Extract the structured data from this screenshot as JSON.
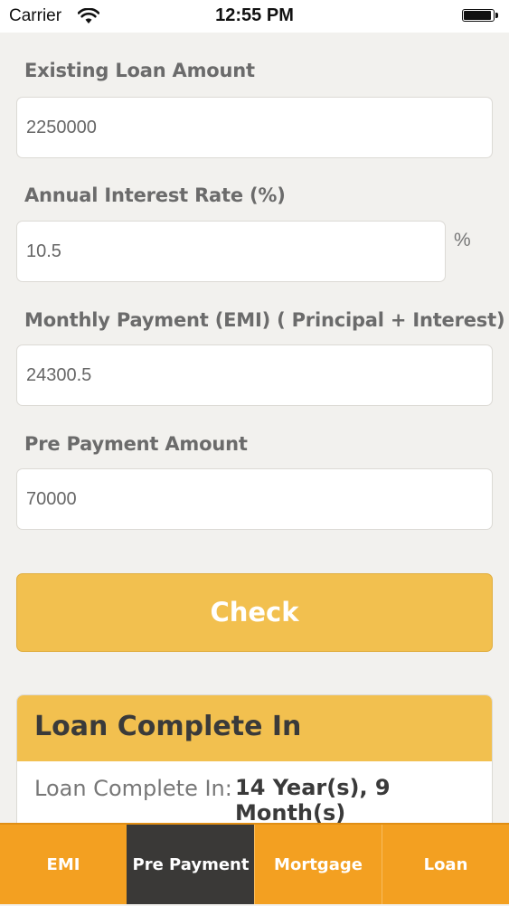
{
  "status_bar": {
    "carrier": "Carrier",
    "time": "12:55 PM"
  },
  "form": {
    "loan_amount": {
      "label": "Existing Loan Amount",
      "value": "2250000"
    },
    "interest_rate": {
      "label": "Annual Interest Rate (%)",
      "value": "10.5",
      "unit": "%"
    },
    "emi": {
      "label": "Monthly Payment (EMI) ( Principal + Interest)",
      "value": "24300.5"
    },
    "prepayment": {
      "label": "Pre Payment Amount",
      "value": "70000"
    },
    "check_label": "Check"
  },
  "result": {
    "title": "Loan Complete In",
    "label": "Loan Complete In:",
    "value": "14 Year(s), 9 Month(s)"
  },
  "tabs": [
    {
      "label": "EMI",
      "active": false
    },
    {
      "label": "Pre Payment",
      "active": true
    },
    {
      "label": "Mortgage",
      "active": false
    },
    {
      "label": "Loan",
      "active": false
    }
  ],
  "colors": {
    "accent": "#f2c04f",
    "tab_bar": "#f3a021",
    "tab_active": "#3a3937",
    "background": "#f2f1ee"
  }
}
